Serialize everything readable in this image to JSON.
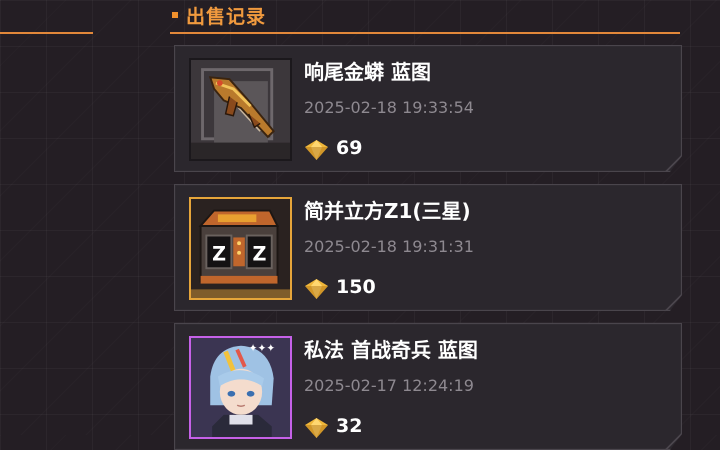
{
  "section": {
    "title": "出售记录"
  },
  "records": [
    {
      "name": "响尾金蟒 蓝图",
      "time": "2025-02-18 19:33:54",
      "price": "69",
      "icon": "weapon-blueprint-icon"
    },
    {
      "name": "简并立方Z1(三星)",
      "time": "2025-02-18 19:31:31",
      "price": "150",
      "icon": "cube-crate-icon"
    },
    {
      "name": "私法 首战奇兵 蓝图",
      "time": "2025-02-17 12:24:19",
      "price": "32",
      "icon": "character-portrait-icon"
    }
  ],
  "colors": {
    "accent": "#e2883a",
    "title": "#f19a3e",
    "gem": "#f0b73a",
    "rare_gold": "#e6a53a",
    "rare_purple": "#c561e8"
  }
}
